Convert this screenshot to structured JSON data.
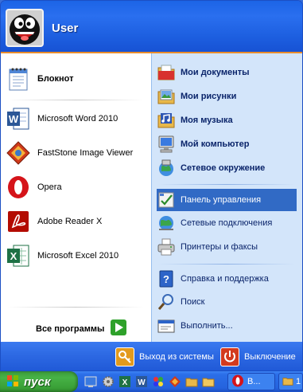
{
  "user": {
    "name": "User"
  },
  "left_pane": {
    "pinned": [
      {
        "label": "Блокнот",
        "icon": "notepad-icon"
      }
    ],
    "recent": [
      {
        "label": "Microsoft Word 2010",
        "icon": "word-icon"
      },
      {
        "label": "FastStone Image Viewer",
        "icon": "faststone-icon"
      },
      {
        "label": "Opera",
        "icon": "opera-icon"
      },
      {
        "label": "Adobe Reader X",
        "icon": "adobe-reader-icon"
      },
      {
        "label": "Microsoft Excel 2010",
        "icon": "excel-icon"
      }
    ],
    "all_programs_label": "Все программы"
  },
  "right_pane": {
    "items": [
      {
        "label": "Мои документы",
        "icon": "my-documents-icon"
      },
      {
        "label": "Мои рисунки",
        "icon": "my-pictures-icon"
      },
      {
        "label": "Моя музыка",
        "icon": "my-music-icon"
      },
      {
        "label": "Мой компьютер",
        "icon": "my-computer-icon"
      },
      {
        "label": "Сетевое окружение",
        "icon": "network-places-icon"
      },
      {
        "label": "Панель управления",
        "icon": "control-panel-icon"
      },
      {
        "label": "Сетевые подключения",
        "icon": "network-connections-icon"
      },
      {
        "label": "Принтеры и факсы",
        "icon": "printers-icon"
      },
      {
        "label": "Справка и поддержка",
        "icon": "help-icon"
      },
      {
        "label": "Поиск",
        "icon": "search-icon"
      },
      {
        "label": "Выполнить...",
        "icon": "run-icon"
      }
    ]
  },
  "footer": {
    "logoff_label": "Выход из системы",
    "shutdown_label": "Выключение"
  },
  "taskbar": {
    "start_label": "пуск",
    "tasks": [
      {
        "label": "В...",
        "icon": "opera-icon"
      },
      {
        "label": "1",
        "icon": "folder-icon"
      }
    ]
  },
  "colors": {
    "header_blue": "#1d5fe0",
    "right_pane_bg": "#d3e5fa",
    "selection": "#316ac5",
    "start_green": "#47b246",
    "orange_line": "#e98d2c"
  }
}
